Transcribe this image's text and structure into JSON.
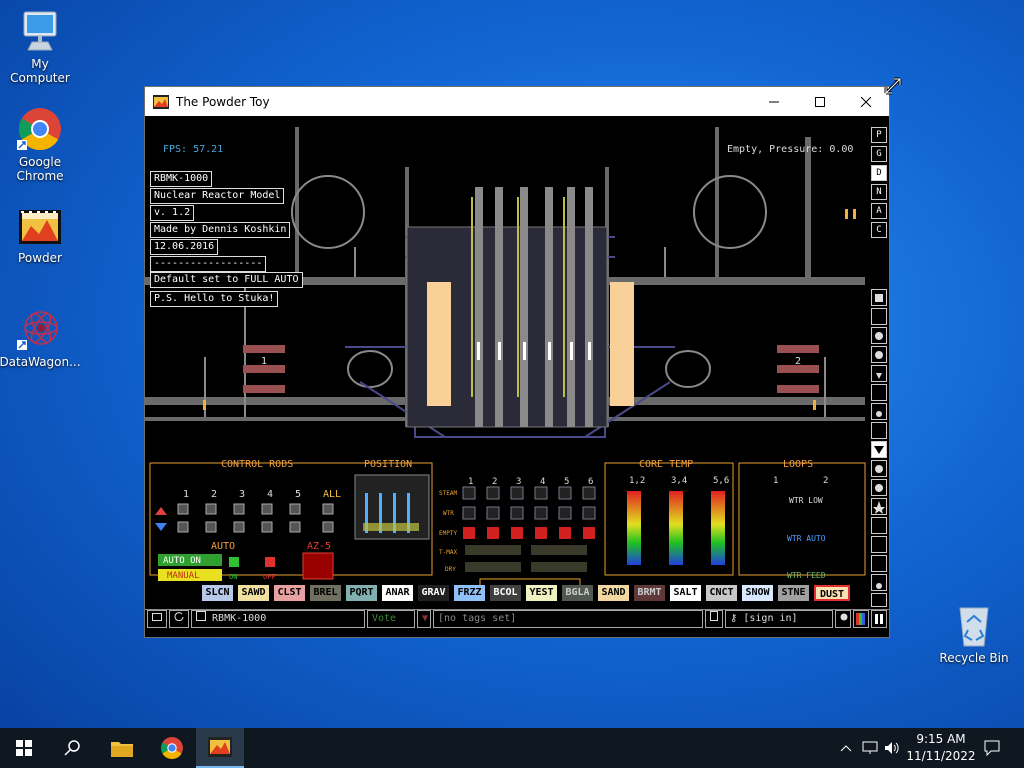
{
  "desktop": {
    "icons": [
      {
        "label": "My Computer"
      },
      {
        "label": "Google Chrome"
      },
      {
        "label": "Powder"
      },
      {
        "label": "DataWagon..."
      },
      {
        "label": "Recycle Bin"
      }
    ]
  },
  "window": {
    "title": "The Powder Toy"
  },
  "game": {
    "fps": "FPS: 57.21",
    "status": "Empty, Pressure: 0.00",
    "labels": [
      "RBMK-1000",
      "Nuclear Reactor Model",
      "v. 1.2",
      "Made by Dennis Koshkin",
      "12.06.2016",
      "Default set to FULL AUTO",
      "P.S. Hello to Stuka!"
    ],
    "divider": "------------------",
    "turbine_1": "1",
    "turbine_2": "2",
    "sections": {
      "control_rods": "CONTROL RODS",
      "position": "POSITION",
      "core_temp": "CORE TEMP",
      "loops": "LOOPS",
      "auto": "AUTO",
      "az5": "AZ-5"
    },
    "rod_numbers": [
      "1",
      "2",
      "3",
      "4",
      "5",
      "ALL"
    ],
    "steam_cols": [
      "1",
      "2",
      "3",
      "4",
      "5",
      "6"
    ],
    "row_labels": [
      "STEAM",
      "WTR",
      "EMPTY",
      "T-MAX",
      "DRY"
    ],
    "core_groups": [
      "1,2",
      "3,4",
      "5,6"
    ],
    "loops_cols": [
      "1",
      "2"
    ],
    "wtr_low": "WTR\nLOW",
    "wtr_auto": "WTR\nAUTO",
    "wtr_feed": "WTR\nFEED",
    "auto_on": "AUTO ON",
    "manual": "MANUAL",
    "on": "ON",
    "off": "OFF",
    "right_tools": [
      "P",
      "G",
      "D",
      "N",
      "A",
      "C"
    ],
    "materials": [
      {
        "name": "SLCN",
        "color": "#b8c8e8"
      },
      {
        "name": "SAWD",
        "color": "#f0e0a0"
      },
      {
        "name": "CLST",
        "color": "#e8a0a0"
      },
      {
        "name": "BREL",
        "color": "#707060"
      },
      {
        "name": "PQRT",
        "color": "#80b0b0"
      },
      {
        "name": "ANAR",
        "color": "#ffffff"
      },
      {
        "name": "GRAV",
        "color": "#202020"
      },
      {
        "name": "FRZZ",
        "color": "#90c0f8"
      },
      {
        "name": "BCOL",
        "color": "#404040"
      },
      {
        "name": "YEST",
        "color": "#f0f0c0"
      },
      {
        "name": "BGLA",
        "color": "#505850"
      },
      {
        "name": "SAND",
        "color": "#f0d8a0"
      },
      {
        "name": "BRMT",
        "color": "#603838"
      },
      {
        "name": "SALT",
        "color": "#ffffff"
      },
      {
        "name": "CNCT",
        "color": "#c8c8c8"
      },
      {
        "name": "SNOW",
        "color": "#d8e8ff"
      },
      {
        "name": "STNE",
        "color": "#a0a0a0"
      },
      {
        "name": "DUST",
        "color": "#f8e0b0"
      }
    ],
    "bottom_bar": {
      "save_name": "RBMK-1000",
      "vote": "Vote",
      "tags": "[no tags set]",
      "sign_in": "[sign in]"
    }
  },
  "taskbar": {
    "time": "9:15 AM",
    "date": "11/11/2022"
  }
}
